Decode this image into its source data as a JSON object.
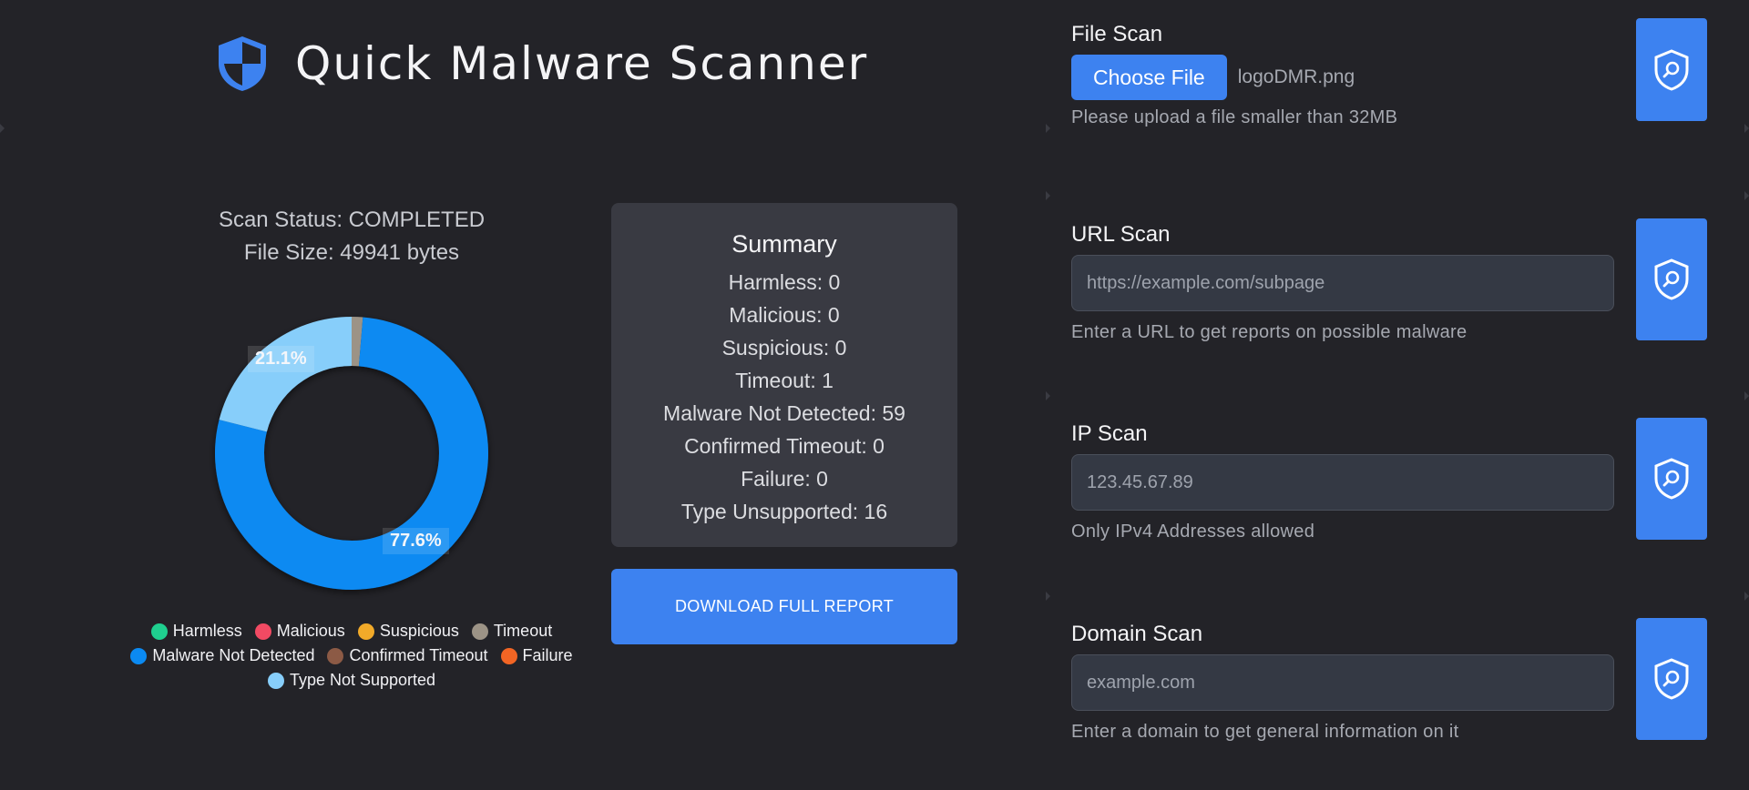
{
  "app": {
    "title": "Quick Malware Scanner",
    "logo_icon": "shield-icon",
    "accent_color": "#3d82f0"
  },
  "status": {
    "scan_status": "Scan Status: COMPLETED",
    "file_size": "File Size: 49941 bytes"
  },
  "chart_data": {
    "type": "pie",
    "categories": [
      "Harmless",
      "Malicious",
      "Suspicious",
      "Timeout",
      "Malware Not Detected",
      "Confirmed Timeout",
      "Failure",
      "Type Not Supported"
    ],
    "values": [
      0,
      0,
      0,
      1,
      59,
      0,
      0,
      16
    ],
    "colors": [
      "#1fcf8f",
      "#f24a63",
      "#f2aa29",
      "#9c9386",
      "#0b8af2",
      "#8c5a45",
      "#f26524",
      "#87cefa"
    ],
    "data_labels": [
      "21.1%",
      "77.6%"
    ],
    "donut": true,
    "legend": "bottom"
  },
  "summary": {
    "title": "Summary",
    "lines": [
      "Harmless: 0",
      "Malicious: 0",
      "Suspicious: 0",
      "Timeout: 1",
      "Malware Not Detected: 59",
      "Confirmed Timeout: 0",
      "Failure: 0",
      "Type Unsupported: 16"
    ]
  },
  "download_label": "DOWNLOAD FULL REPORT",
  "scans": {
    "file": {
      "title": "File Scan",
      "button_label": "Choose File",
      "file_name": "logoDMR.png",
      "hint": "Please upload a file smaller than 32MB"
    },
    "url": {
      "title": "URL Scan",
      "placeholder": "https://example.com/subpage",
      "hint": "Enter a URL to get reports on possible malware"
    },
    "ip": {
      "title": "IP Scan",
      "placeholder": "123.45.67.89",
      "hint": "Only IPv4 Addresses allowed"
    },
    "domain": {
      "title": "Domain Scan",
      "placeholder": "example.com",
      "hint": "Enter a domain to get general information on it"
    },
    "scan_button_icon": "shield-search-icon"
  }
}
